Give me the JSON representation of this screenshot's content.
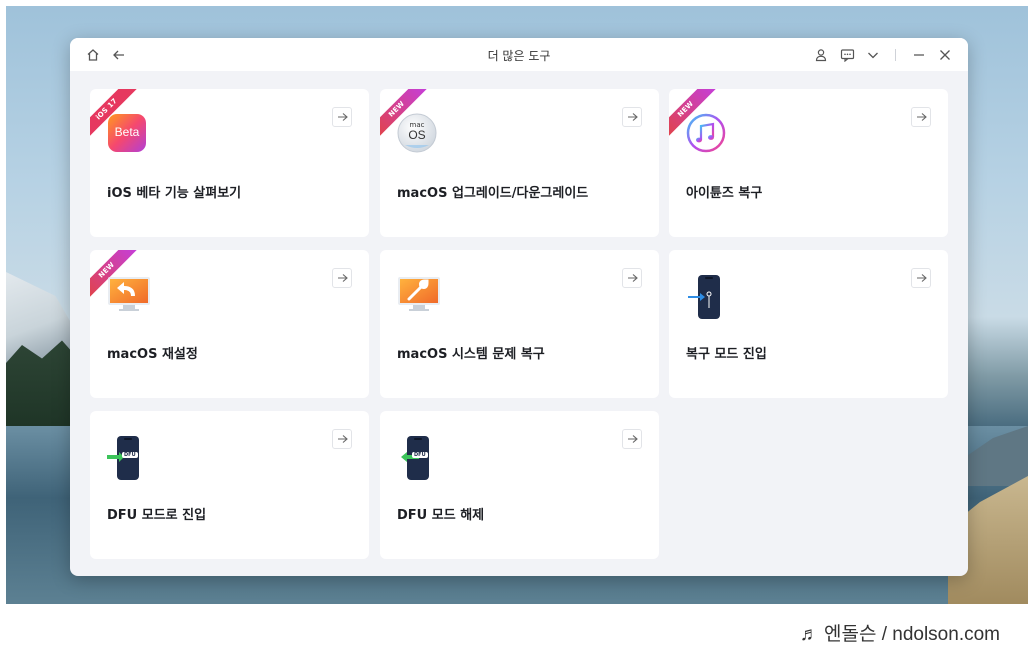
{
  "window": {
    "title": "더 많은 도구"
  },
  "icons": {
    "home": "home-icon",
    "back": "back-arrow-icon",
    "user": "user-icon",
    "feedback": "feedback-icon",
    "menu": "chevron-down-icon",
    "minimize": "minimize-icon",
    "close": "close-icon",
    "card_arrow": "arrow-right-icon"
  },
  "cards": [
    {
      "label": "iOS 베타 기능 살펴보기",
      "badge": "iOS 17",
      "icon": "beta-app-icon",
      "icon_text": "Beta"
    },
    {
      "label": "macOS 업그레이드/다운그레이드",
      "badge": "NEW",
      "icon": "macos-icon",
      "icon_text_top": "mac",
      "icon_text": "OS"
    },
    {
      "label": "아이튠즈 복구",
      "badge": "NEW",
      "icon": "itunes-icon"
    },
    {
      "label": "macOS 재설정",
      "badge": "NEW",
      "icon": "mac-reset-icon"
    },
    {
      "label": "macOS 시스템 문제 복구",
      "icon": "mac-repair-icon"
    },
    {
      "label": "복구 모드 진입",
      "icon": "recovery-mode-phone-icon"
    },
    {
      "label": "DFU 모드로 진입",
      "icon": "dfu-enter-phone-icon",
      "icon_text": "DFU"
    },
    {
      "label": "DFU 모드 해제",
      "icon": "dfu-exit-phone-icon",
      "icon_text": "DFU"
    }
  ],
  "colors": {
    "badge_ios": "#e6385f",
    "badge_new_start": "#e4433a",
    "badge_new_end": "#c43ee0",
    "window_bg": "#f2f3f7"
  },
  "watermark": {
    "text": "♬ 엔돌슨 / ndolson.com"
  }
}
